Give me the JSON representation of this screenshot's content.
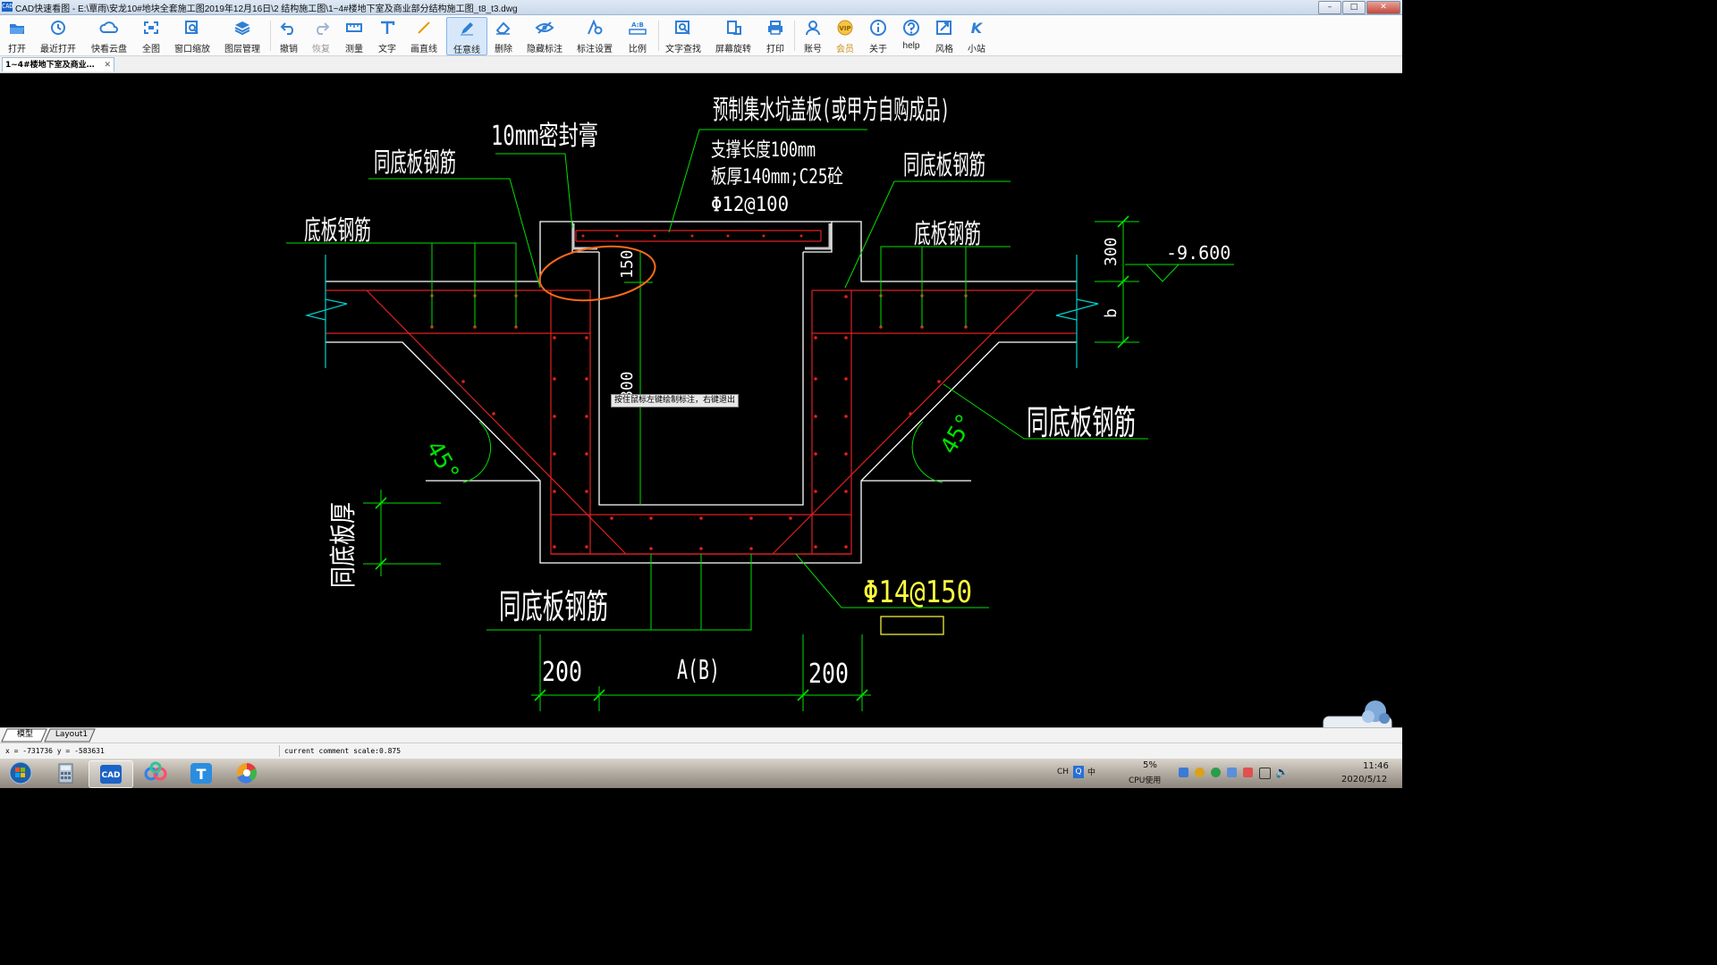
{
  "window": {
    "title": "CAD快速看图 - E:\\覃雨\\安龙10#地块全套施工图2019年12月16日\\2    结构施工图\\1~4#楼地下室及商业部分结构施工图_t8_t3.dwg",
    "app_icon_text": "CAD",
    "controls": {
      "minimize": "–",
      "maximize": "□",
      "close": "✕"
    }
  },
  "toolbar": {
    "items": [
      {
        "id": "open",
        "label": "打开",
        "icon": "folder-open-icon"
      },
      {
        "id": "recent",
        "label": "最近打开",
        "icon": "recent-clock-icon"
      },
      {
        "id": "cloud",
        "label": "快看云盘",
        "icon": "cloud-icon"
      },
      {
        "id": "fullview",
        "label": "全图",
        "icon": "fullview-icon"
      },
      {
        "id": "zoomwin",
        "label": "窗口缩放",
        "icon": "zoom-window-icon"
      },
      {
        "id": "layers",
        "label": "图层管理",
        "icon": "layers-icon"
      },
      {
        "id": "undo",
        "label": "撤销",
        "icon": "undo-icon"
      },
      {
        "id": "redo",
        "label": "恢复",
        "icon": "redo-icon"
      },
      {
        "id": "measure",
        "label": "测量",
        "icon": "measure-icon"
      },
      {
        "id": "text",
        "label": "文字",
        "icon": "text-icon"
      },
      {
        "id": "line",
        "label": "画直线",
        "icon": "line-icon"
      },
      {
        "id": "freeline",
        "label": "任意线",
        "icon": "pencil-icon",
        "active": true
      },
      {
        "id": "erase",
        "label": "删除",
        "icon": "eraser-icon"
      },
      {
        "id": "hideann",
        "label": "隐藏标注",
        "icon": "eye-hide-icon"
      },
      {
        "id": "annset",
        "label": "标注设置",
        "icon": "annotation-settings-icon"
      },
      {
        "id": "ratio",
        "label": "比例",
        "icon": "ratio-icon",
        "icon_text": "A:B"
      },
      {
        "id": "findtext",
        "label": "文字查找",
        "icon": "find-text-icon"
      },
      {
        "id": "rotate",
        "label": "屏幕旋转",
        "icon": "rotate-screen-icon"
      },
      {
        "id": "print",
        "label": "打印",
        "icon": "printer-icon"
      },
      {
        "id": "account",
        "label": "账号",
        "icon": "user-icon"
      },
      {
        "id": "vip",
        "label": "会员",
        "icon": "vip-icon",
        "icon_text": "VIP"
      },
      {
        "id": "about",
        "label": "关于",
        "icon": "info-icon"
      },
      {
        "id": "help",
        "label": "help",
        "icon": "help-icon"
      },
      {
        "id": "style",
        "label": "风格",
        "icon": "style-icon"
      },
      {
        "id": "site",
        "label": "小站",
        "icon": "site-k-icon",
        "icon_text": "K"
      }
    ]
  },
  "document_tab": {
    "label": "1~4#楼地下室及商业…",
    "close": "✕"
  },
  "drawing": {
    "labels": {
      "top_title": "预制集水坑盖板(或甲方自购成品)",
      "support": "支撑长度100mm",
      "thickness": "板厚140mm;C25砼",
      "rebar_top": "Φ12@100",
      "sealant": "10mm密封膏",
      "same_rebar_tl": "同底板钢筋",
      "same_rebar_tr": "同底板钢筋",
      "bottom_rebar_l": "底板钢筋",
      "bottom_rebar_r": "底板钢筋",
      "same_rebar_r": "同底板钢筋",
      "same_rebar_bottom": "同底板钢筋",
      "same_thickness": "同底板厚",
      "rebar_bottom": "Φ14@150",
      "dim_150": "150",
      "dim_300": "300",
      "dim_b": "b",
      "dim_800": "800",
      "elevation": "-9.600",
      "angle_l": "45°",
      "angle_r": "45°",
      "dim_200_l": "200",
      "dim_ab": "A(B)",
      "dim_200_r": "200"
    },
    "tooltip": "按住鼠标左键绘制标注，右键退出",
    "colors": {
      "green": "#00e000",
      "white": "#ffffff",
      "red": "#e02020",
      "cyan": "#00d0d0",
      "yellow": "#ffff40",
      "orange": "#ff6a1a"
    }
  },
  "layout_tabs": [
    {
      "label": "模型",
      "active": true
    },
    {
      "label": "Layout1",
      "active": false
    }
  ],
  "status": {
    "coords": "x = -731736  y = -583631",
    "scale": "current comment scale:0.875"
  },
  "taskbar": {
    "apps": [
      {
        "name": "start-button"
      },
      {
        "name": "calculator-app"
      },
      {
        "name": "cad-app",
        "text": "CAD",
        "active": true
      },
      {
        "name": "baidu-netdisk-app"
      },
      {
        "name": "text-app",
        "text": "T"
      },
      {
        "name": "browser-app"
      }
    ],
    "tray": {
      "lang": "CH",
      "ime": "中",
      "cpu_percent": "5%",
      "cpu_label": "CPU使用",
      "time": "11:46",
      "date": "2020/5/12"
    }
  }
}
